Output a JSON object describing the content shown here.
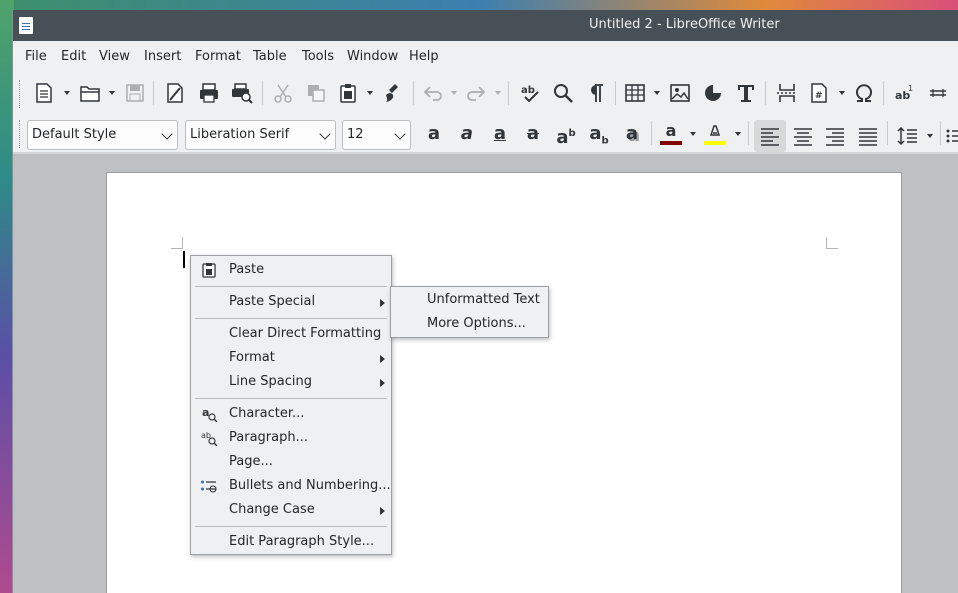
{
  "window": {
    "title": "Untitled 2 - LibreOffice Writer"
  },
  "menubar": {
    "items": [
      "File",
      "Edit",
      "View",
      "Insert",
      "Format",
      "Table",
      "Tools",
      "Window",
      "Help"
    ]
  },
  "formatting": {
    "paragraph_style": "Default Style",
    "font_name": "Liberation Serif",
    "font_size": "12",
    "font_color": "#800000",
    "highlight_color": "#ffff00"
  },
  "context_menu": {
    "items": [
      {
        "label": "Paste",
        "icon": "clipboard-icon"
      },
      {
        "label": "Paste Special",
        "has_submenu": true
      },
      {
        "label": "Clear Direct Formatting"
      },
      {
        "label": "Format",
        "has_submenu": true
      },
      {
        "label": "Line Spacing",
        "has_submenu": true
      },
      {
        "label": "Character...",
        "icon": "character-icon"
      },
      {
        "label": "Paragraph...",
        "icon": "paragraph-icon"
      },
      {
        "label": "Page..."
      },
      {
        "label": "Bullets and Numbering...",
        "icon": "bullets-icon"
      },
      {
        "label": "Change Case",
        "has_submenu": true
      },
      {
        "label": "Edit Paragraph Style..."
      }
    ]
  },
  "submenu": {
    "items": [
      {
        "label": "Unformatted Text"
      },
      {
        "label": "More Options..."
      }
    ]
  }
}
